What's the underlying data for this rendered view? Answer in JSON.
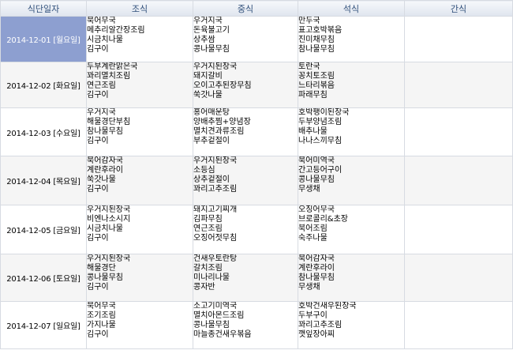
{
  "headers": [
    "식단일자",
    "조식",
    "중식",
    "석식",
    "간식"
  ],
  "rows": [
    {
      "date": "2014-12-01 [월요일]",
      "selected": true,
      "breakfast": [
        "북어무국",
        "메추리알간장조림",
        "시금치나물",
        "김구이"
      ],
      "lunch": [
        "우거지국",
        "돈육불고기",
        "상추쌈",
        "콩나물무침"
      ],
      "dinner": [
        "만두국",
        "표고호박볶음",
        "진미채무침",
        "참나물무침"
      ],
      "snack": []
    },
    {
      "date": "2014-12-02 [화요일]",
      "selected": false,
      "breakfast": [
        "두부계란맑은국",
        "꽈리멸치조림",
        "연근조림",
        "김구이"
      ],
      "lunch": [
        "우거지된장국",
        "돼지갈비",
        "오이고추된장무침",
        "쑥갓나물"
      ],
      "dinner": [
        "토란국",
        "꽁치토조림",
        "느타리볶음",
        "파래무침"
      ],
      "snack": []
    },
    {
      "date": "2014-12-03 [수요일]",
      "selected": false,
      "breakfast": [
        "우거지국",
        "해물경단부침",
        "참나물무침",
        "김구이"
      ],
      "lunch": [
        "홍어매운탕",
        "양배추찜+양념장",
        "멸치견과류조림",
        "부추겉절이"
      ],
      "dinner": [
        "호박팽이된장국",
        "두부양념조림",
        "배추나물",
        "나나스끼무침"
      ],
      "snack": []
    },
    {
      "date": "2014-12-04 [목요일]",
      "selected": false,
      "breakfast": [
        "북어감자국",
        "계란후라이",
        "쑥갓나물",
        "김구이"
      ],
      "lunch": [
        "우거지된장국",
        "소등심",
        "상추겉절이",
        "꽈리고추조림"
      ],
      "dinner": [
        "북어미역국",
        "간고등어구이",
        "콩나물무침",
        "무생채"
      ],
      "snack": []
    },
    {
      "date": "2014-12-05 [금요일]",
      "selected": false,
      "breakfast": [
        "우거지된장국",
        "비엔나소시지",
        "시금치나물",
        "김구이"
      ],
      "lunch": [
        "돼지고기찌개",
        "김파무침",
        "연근조림",
        "오징어젓무침"
      ],
      "dinner": [
        "오징어무국",
        "브로콜리&초장",
        "북어조림",
        "숙주나물"
      ],
      "snack": []
    },
    {
      "date": "2014-12-06 [토요일]",
      "selected": false,
      "breakfast": [
        "우거지된장국",
        "해물경단",
        "콩나물무침",
        "김구이"
      ],
      "lunch": [
        "건새우토란탕",
        "갈치조림",
        "미나리나물",
        "콩자반"
      ],
      "dinner": [
        "북어감자국",
        "계란후라이",
        "참나물무침",
        "무생채"
      ],
      "snack": []
    },
    {
      "date": "2014-12-07 [일요일]",
      "selected": false,
      "breakfast": [
        "북어무국",
        "조기조림",
        "가지나물",
        "김구이"
      ],
      "lunch": [
        "소고기미역국",
        "멸치아몬드조림",
        "콩나물무침",
        "마늘종건새우볶음"
      ],
      "dinner": [
        "호박건새우된장국",
        "두부구이",
        "꽈리고추조림",
        "깻잎장아찌"
      ],
      "snack": []
    }
  ]
}
